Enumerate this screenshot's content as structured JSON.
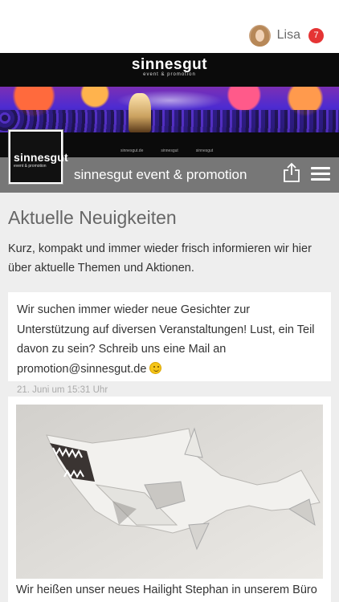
{
  "user": {
    "name": "Lisa",
    "notifications": "7"
  },
  "banner": {
    "logo_title": "sinnesgut",
    "logo_subtitle": "event & promotion",
    "social": [
      "sinnesgut.de",
      "sinnesgut",
      "sinnesgut"
    ]
  },
  "profile": {
    "logo_title": "sinnesgut",
    "logo_subtitle": "event & promotion"
  },
  "header": {
    "title": "sinnesgut event & promotion"
  },
  "section": {
    "title": "Aktuelle Neuigkeiten",
    "intro": "Kurz, kompakt und immer wieder frisch informieren wir hier über aktuelle Themen und Aktionen."
  },
  "posts": [
    {
      "text": "Wir suchen immer wieder neue Gesichter zur Unterstützung auf diversen Veranstaltungen! Lust, ein Teil davon zu sein? Schreib uns eine Mail an promotion@sinnesgut.de",
      "time": "21. Juni um 15:31 Uhr"
    },
    {
      "text": "Wir heißen unser neues Hailight Stephan in unserem Büro"
    }
  ],
  "colors": {
    "header_bar": "#777777",
    "badge": "#e53434",
    "background": "#eeeeee"
  }
}
